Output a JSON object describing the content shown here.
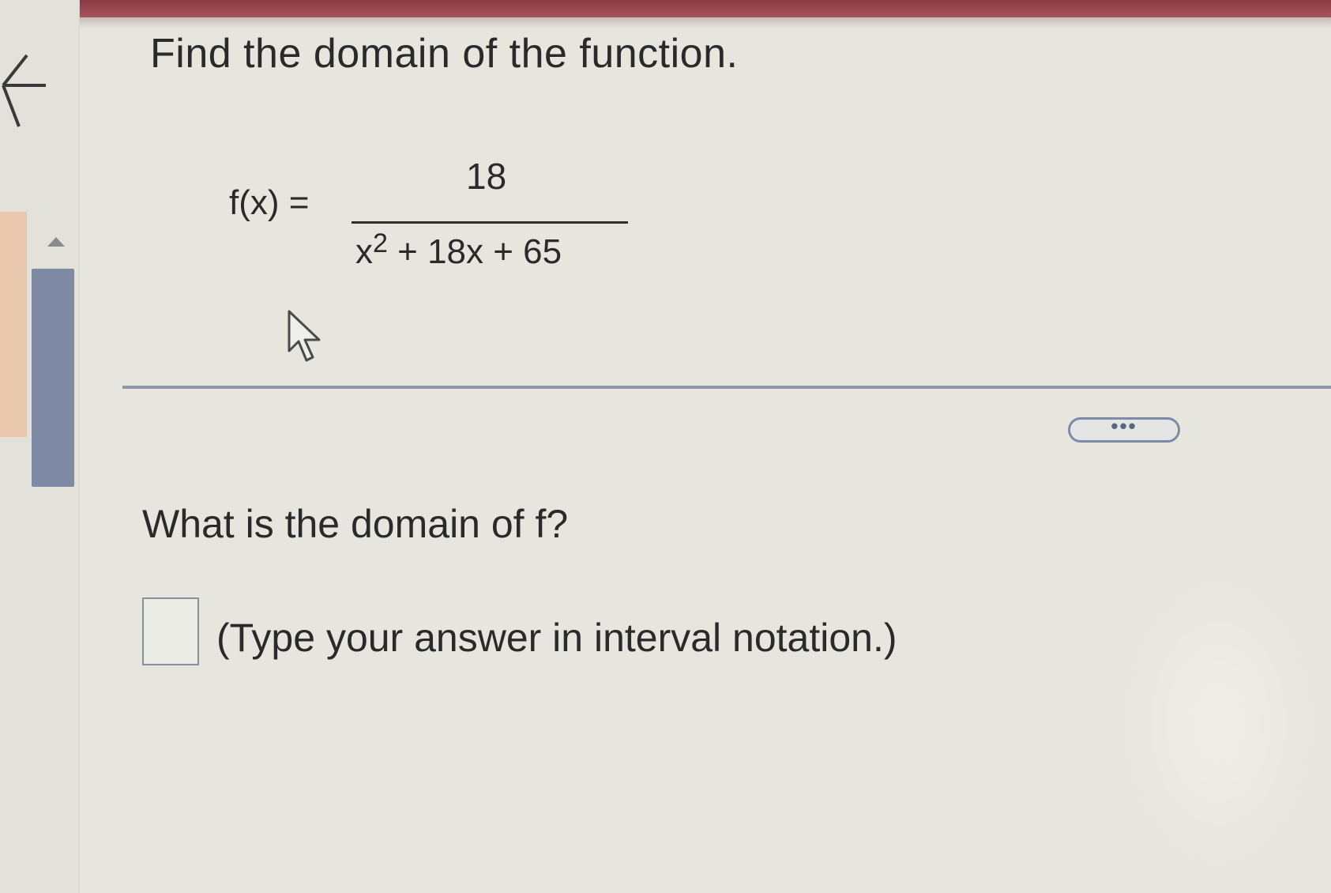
{
  "header": {
    "accent_color": "#8a3a44"
  },
  "sidebar": {
    "back_icon": "back-arrow-icon",
    "scroll_up_icon": "caret-up-icon"
  },
  "problem": {
    "title": "Find the domain of the function.",
    "function_lhs": "f(x) =",
    "numerator": "18",
    "denominator_base": "x",
    "denominator_exponent": "2",
    "denominator_rest": " + 18x + 65"
  },
  "toolbar": {
    "more_label": "•••"
  },
  "question": {
    "prompt": "What is the domain of f?",
    "answer_value": "",
    "hint": "(Type your answer in interval notation.)"
  }
}
